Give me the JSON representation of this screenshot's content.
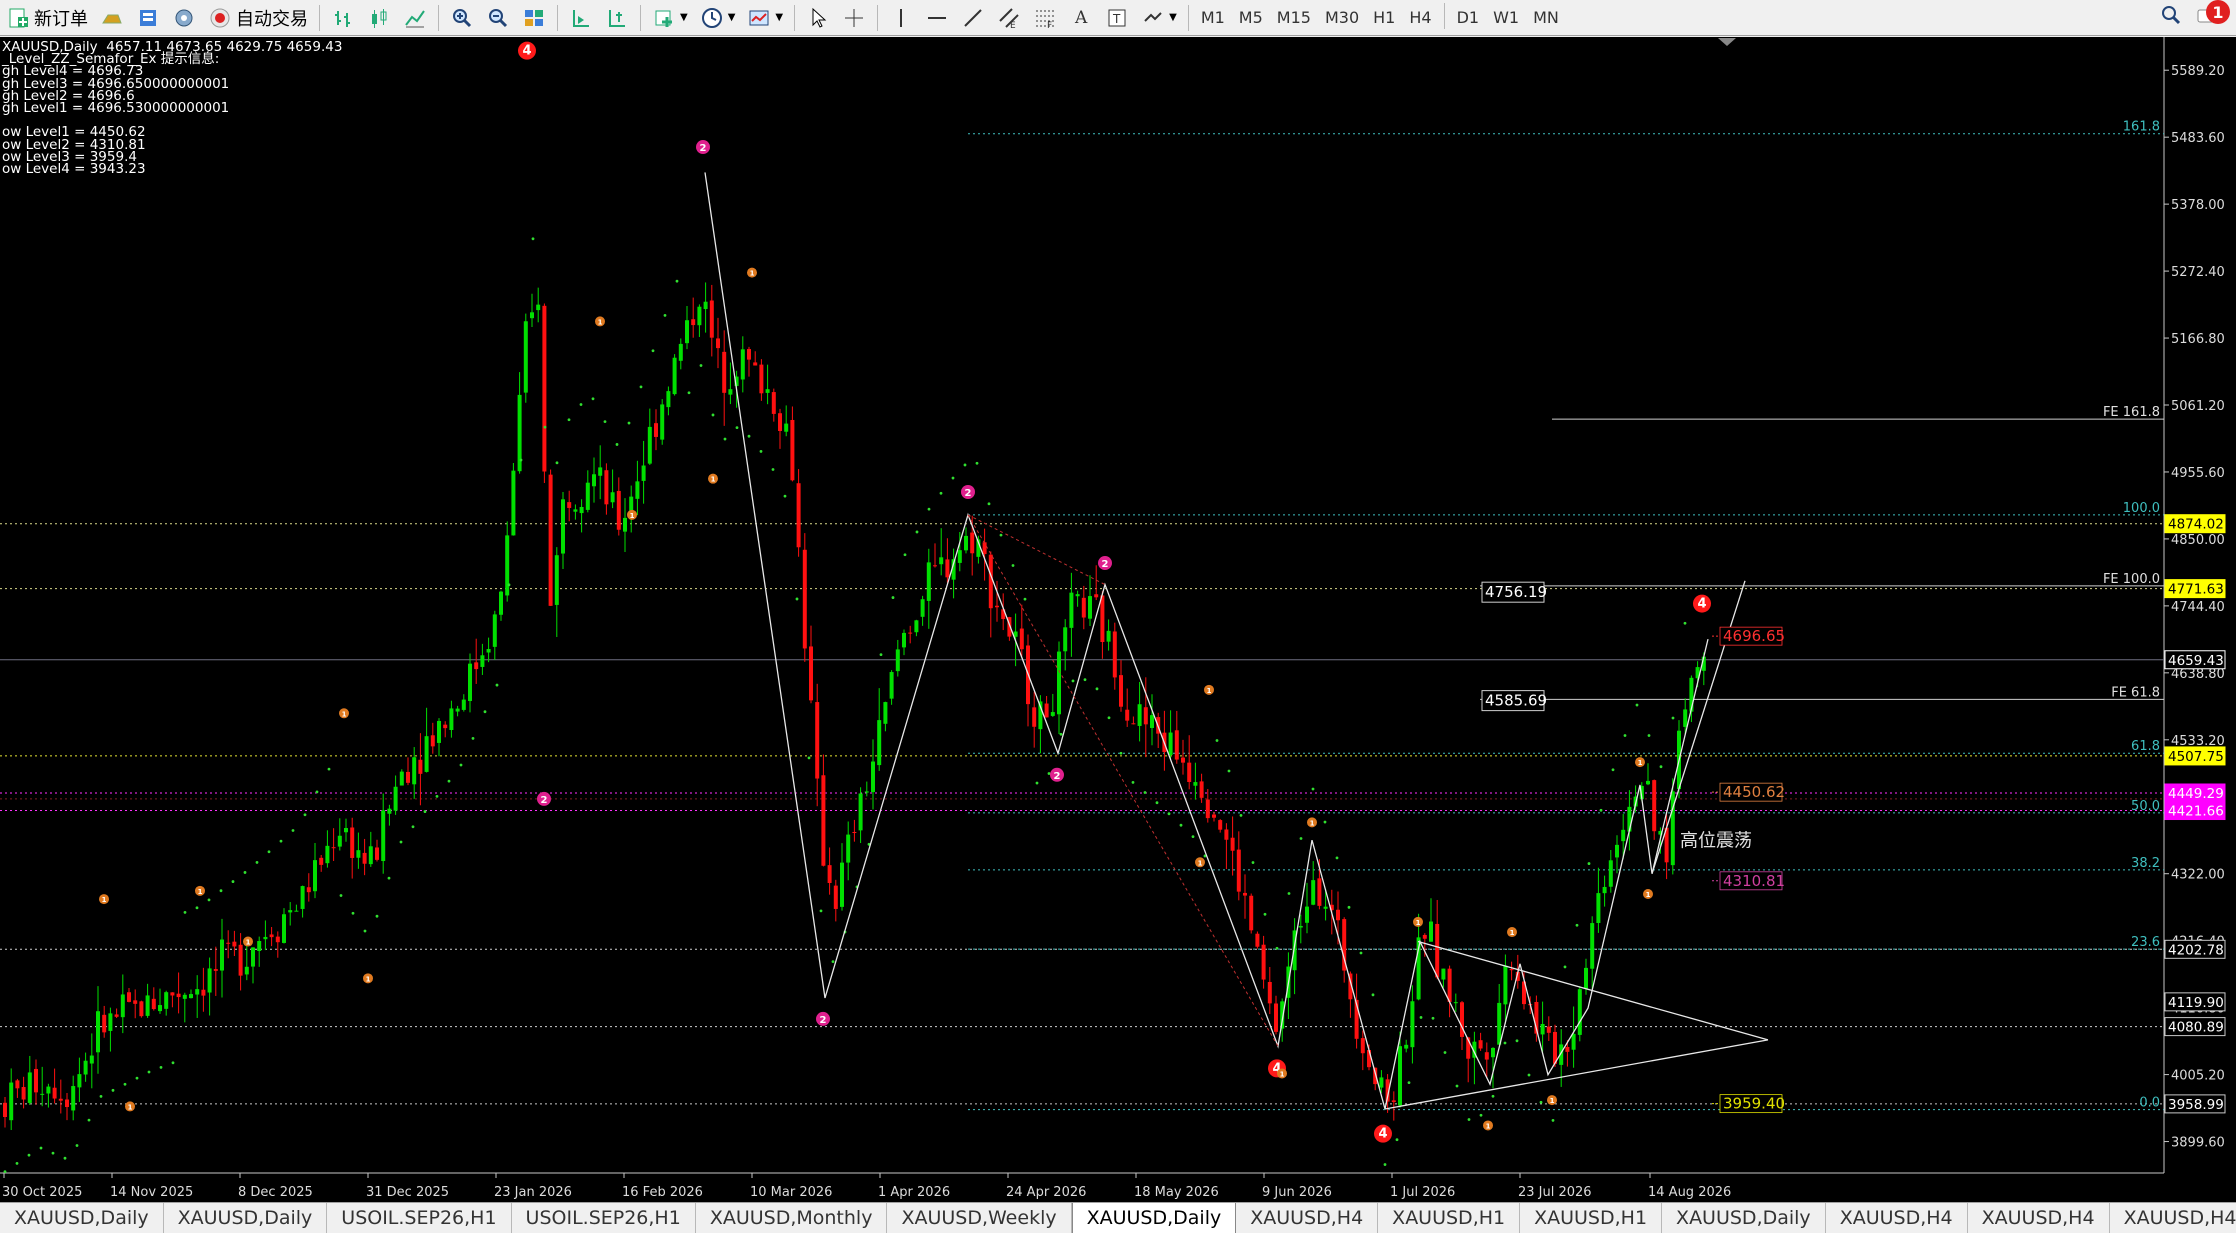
{
  "toolbar": {
    "new_order": "新订单",
    "auto_trade": "自动交易",
    "timeframes": [
      "M1",
      "M5",
      "M15",
      "M30",
      "H1",
      "H4",
      "D1",
      "W1",
      "MN"
    ],
    "notifications": "1"
  },
  "chart": {
    "info_lines": [
      "XAUUSD,Daily  4657.11 4673.65 4629.75 4659.43",
      "_Level_ZZ_Semafor_Ex 提示信息:",
      "gh Level4 = 4696.73",
      "gh Level3 = 4696.650000000001",
      "gh Level2 = 4696.6",
      "gh Level1 = 4696.530000000001",
      "",
      "ow Level1 = 4450.62",
      "ow Level2 = 4310.81",
      "ow Level3 = 3959.4",
      "ow Level4 = 3943.23"
    ],
    "annotation": "高位震荡",
    "fib_labels": [
      "161.8",
      "100.0",
      "61.8",
      "50.0",
      "38.2",
      "23.6",
      "0.0"
    ],
    "fe_labels": [
      "FE 161.8",
      "FE 100.0",
      "FE 61.8"
    ],
    "box_labels": [
      "4756.19",
      "4585.69"
    ],
    "level_labels": [
      "4696.65",
      "4450.62",
      "4310.81",
      "3959.40"
    ],
    "semafor_labels": [
      "4",
      "2",
      "1"
    ],
    "colors": {
      "bull": "#00e000",
      "bear": "#ff1010",
      "fib": "#3fbfbf",
      "yellow": "#ffff00",
      "magenta": "#ff00ff",
      "semafor4": "#ff1a1a",
      "semafor2": "#e0208e",
      "semafor1": "#e07a20"
    }
  },
  "chart_data": {
    "type": "candlestick",
    "symbol": "XAUUSD",
    "timeframe": "Daily",
    "ohlc_current": {
      "open": 4657.11,
      "high": 4673.65,
      "low": 4629.75,
      "close": 4659.43
    },
    "ylim": [
      3850,
      5640
    ],
    "x_labels": [
      "30 Oct 2025",
      "14 Nov 2025",
      "8 Dec 2025",
      "31 Dec 2025",
      "23 Jan 2026",
      "16 Feb 2026",
      "10 Mar 2026",
      "1 Apr 2026",
      "24 Apr 2026",
      "18 May 2026",
      "9 Jun 2026",
      "1 Jul 2026",
      "23 Jul 2026",
      "14 Aug 2026"
    ],
    "y_ticks": [
      "5589.20",
      "5483.60",
      "5378.00",
      "5272.40",
      "5166.80",
      "5061.20",
      "4955.60",
      "4850.00",
      "4744.40",
      "4638.80",
      "4533.20",
      "4427.60",
      "4322.00",
      "4216.40",
      "4110.80",
      "4005.20",
      "3899.60"
    ],
    "price_badges": [
      {
        "value": "4874.02"
      },
      {
        "value": "4771.63"
      },
      {
        "value": "4659.43"
      },
      {
        "value": "4507.75"
      },
      {
        "value": "4449.29"
      },
      {
        "value": "4421.66"
      },
      {
        "value": "4202.78"
      },
      {
        "value": "4119.90"
      },
      {
        "value": "4080.89"
      },
      {
        "value": "3958.99"
      }
    ],
    "zigzag_swings": [
      5430,
      4125,
      4888,
      4512,
      4770,
      4050,
      4370,
      3950,
      4210,
      3990,
      4180,
      4000,
      4100,
      4460,
      4320,
      4690
    ]
  },
  "tabs": [
    {
      "label": "XAUUSD,Daily",
      "active": false
    },
    {
      "label": "XAUUSD,Daily",
      "active": false
    },
    {
      "label": "USOIL.SEP26,H1",
      "active": false
    },
    {
      "label": "USOIL.SEP26,H1",
      "active": false
    },
    {
      "label": "XAUUSD,Monthly",
      "active": false
    },
    {
      "label": "XAUUSD,Weekly",
      "active": false
    },
    {
      "label": "XAUUSD,Daily",
      "active": true
    },
    {
      "label": "XAUUSD,H4",
      "active": false
    },
    {
      "label": "XAUUSD,H1",
      "active": false
    },
    {
      "label": "XAUUSD,H1",
      "active": false
    },
    {
      "label": "XAUUSD,Daily",
      "active": false
    },
    {
      "label": "XAUUSD,H4",
      "active": false
    },
    {
      "label": "XAUUSD,H4",
      "active": false
    },
    {
      "label": "XAUUSD,H4",
      "active": false
    },
    {
      "label": "XAU",
      "active": false
    }
  ]
}
